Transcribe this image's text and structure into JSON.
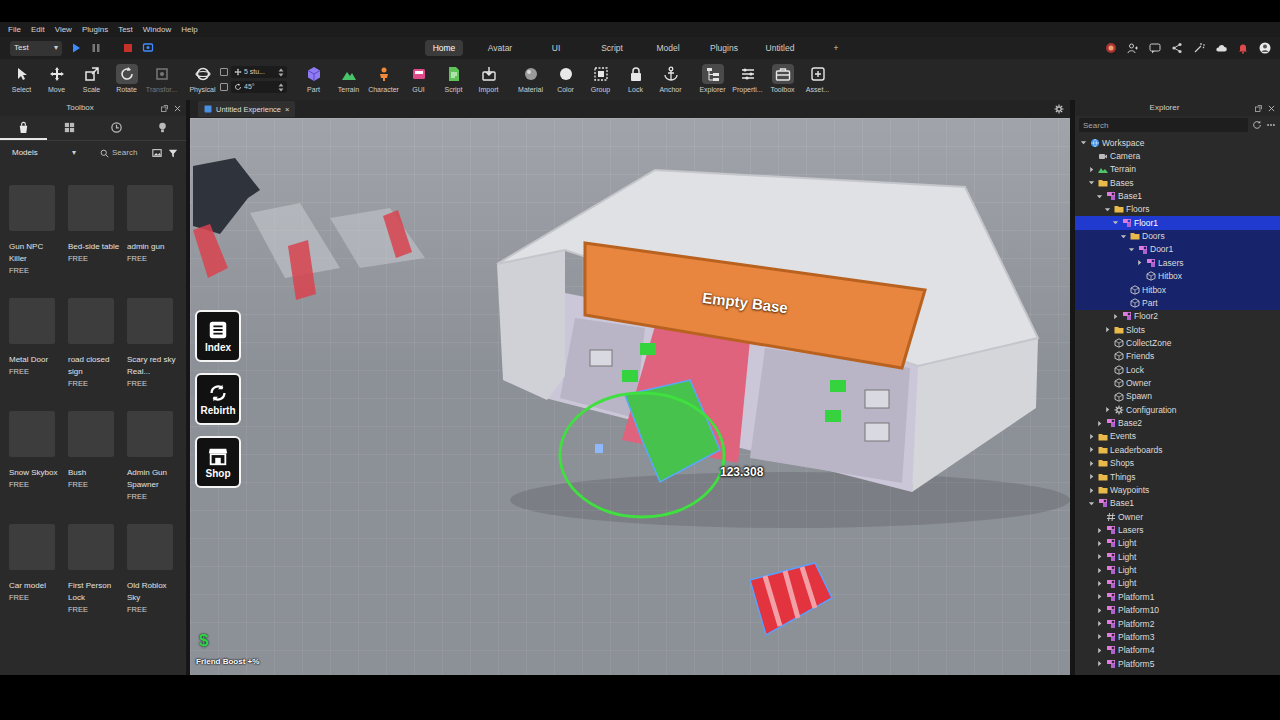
{
  "menu": [
    "File",
    "Edit",
    "View",
    "Plugins",
    "Test",
    "Window",
    "Help"
  ],
  "mode_select": {
    "label": "Test",
    "arrow": "▾"
  },
  "tabs": [
    {
      "label": "Home",
      "selected": true
    },
    {
      "label": "Avatar",
      "selected": false
    },
    {
      "label": "UI",
      "selected": false
    },
    {
      "label": "Script",
      "selected": false
    },
    {
      "label": "Model",
      "selected": false
    },
    {
      "label": "Plugins",
      "selected": false
    },
    {
      "label": "Untitled",
      "selected": false
    },
    {
      "label": "+",
      "selected": false
    }
  ],
  "ribbon": {
    "groups": [
      {
        "kind": "tools",
        "items": [
          {
            "label": "Select",
            "selected": false,
            "disabled": false
          },
          {
            "label": "Move",
            "selected": false,
            "disabled": false
          },
          {
            "label": "Scale",
            "selected": false,
            "disabled": false
          },
          {
            "label": "Rotate",
            "selected": true,
            "disabled": false
          },
          {
            "label": "Transfor...",
            "selected": false,
            "disabled": true
          }
        ]
      },
      {
        "kind": "snap",
        "label": "Physical",
        "fields": [
          {
            "value": "5 stu...",
            "checked": false
          },
          {
            "value": "45°",
            "checked": false
          }
        ]
      },
      {
        "kind": "tools",
        "items": [
          {
            "label": "Part",
            "selected": false,
            "disabled": false
          },
          {
            "label": "Terrain",
            "selected": false,
            "disabled": false
          },
          {
            "label": "Character",
            "selected": false,
            "disabled": false
          },
          {
            "label": "GUI",
            "selected": false,
            "disabled": false
          },
          {
            "label": "Script",
            "selected": false,
            "disabled": false
          },
          {
            "label": "Import",
            "selected": false,
            "disabled": false
          }
        ]
      },
      {
        "kind": "tools",
        "items": [
          {
            "label": "Material",
            "selected": false,
            "disabled": false
          },
          {
            "label": "Color",
            "selected": false,
            "disabled": false
          },
          {
            "label": "Group",
            "selected": false,
            "disabled": false
          },
          {
            "label": "Lock",
            "selected": false,
            "disabled": false
          },
          {
            "label": "Anchor",
            "selected": false,
            "disabled": false
          }
        ]
      },
      {
        "kind": "tools",
        "items": [
          {
            "label": "Explorer",
            "selected": true,
            "disabled": false
          },
          {
            "label": "Properti...",
            "selected": false,
            "disabled": false
          },
          {
            "label": "Toolbox",
            "selected": true,
            "disabled": false
          },
          {
            "label": "Asset...",
            "selected": false,
            "disabled": false
          }
        ]
      }
    ]
  },
  "toolbox": {
    "title": "Toolbox",
    "tabs": [
      {
        "selected": true
      },
      {
        "selected": false
      },
      {
        "selected": false
      },
      {
        "selected": false
      }
    ],
    "category": {
      "label": "Models",
      "arrow": "▾"
    },
    "search": {
      "label": "Search"
    },
    "items": [
      {
        "name": "Gun NPC Killer",
        "price": "FREE"
      },
      {
        "name": "Bed-side table",
        "price": "FREE"
      },
      {
        "name": "admin gun",
        "price": "FREE"
      },
      {
        "name": "Metal Door",
        "price": "FREE"
      },
      {
        "name": "road closed sign",
        "price": "FREE"
      },
      {
        "name": "Scary red sky Real...",
        "price": "FREE"
      },
      {
        "name": "Snow Skybox",
        "price": "FREE"
      },
      {
        "name": "Bush",
        "price": "FREE"
      },
      {
        "name": "Admin Gun Spawner",
        "price": "FREE"
      },
      {
        "name": "Car model",
        "price": "FREE"
      },
      {
        "name": "First Person Lock",
        "price": "FREE"
      },
      {
        "name": "Old Roblox Sky",
        "price": "FREE"
      }
    ]
  },
  "viewport": {
    "tab": {
      "label": "Untitled Experience",
      "close": "×"
    },
    "hud_buttons": [
      {
        "label": "Index"
      },
      {
        "label": "Rebirth"
      },
      {
        "label": "Shop"
      }
    ],
    "currency_icon": "$",
    "friend_boost": "Friend Boost +%",
    "sign": "Empty Base",
    "rotation_readout": "123.308"
  },
  "explorer": {
    "title": "Explorer",
    "search": {
      "placeholder": "Search"
    },
    "items": [
      {
        "name": "Workspace",
        "depth": 0,
        "kind": "service",
        "toggle": "open",
        "selected": false,
        "highlighted": false
      },
      {
        "name": "Camera",
        "depth": 1,
        "kind": "camera",
        "toggle": "none",
        "selected": false,
        "highlighted": false
      },
      {
        "name": "Terrain",
        "depth": 1,
        "kind": "terrain",
        "toggle": "closed",
        "selected": false,
        "highlighted": false
      },
      {
        "name": "Bases",
        "depth": 1,
        "kind": "folder",
        "toggle": "open",
        "selected": false,
        "highlighted": false
      },
      {
        "name": "Base1",
        "depth": 2,
        "kind": "model",
        "toggle": "open",
        "selected": false,
        "highlighted": false
      },
      {
        "name": "Floors",
        "depth": 3,
        "kind": "folder",
        "toggle": "open",
        "selected": false,
        "highlighted": false
      },
      {
        "name": "Floor1",
        "depth": 4,
        "kind": "model",
        "toggle": "open",
        "selected": true,
        "highlighted": false
      },
      {
        "name": "Doors",
        "depth": 5,
        "kind": "folder",
        "toggle": "open",
        "selected": false,
        "highlighted": true
      },
      {
        "name": "Door1",
        "depth": 6,
        "kind": "model",
        "toggle": "open",
        "selected": false,
        "highlighted": true
      },
      {
        "name": "Lasers",
        "depth": 7,
        "kind": "model",
        "toggle": "closed",
        "selected": false,
        "highlighted": true
      },
      {
        "name": "Hitbox",
        "depth": 7,
        "kind": "part",
        "toggle": "none",
        "selected": false,
        "highlighted": true
      },
      {
        "name": "Hitbox",
        "depth": 5,
        "kind": "part",
        "toggle": "none",
        "selected": false,
        "highlighted": true
      },
      {
        "name": "Part",
        "depth": 5,
        "kind": "part",
        "toggle": "none",
        "selected": false,
        "highlighted": true
      },
      {
        "name": "Floor2",
        "depth": 4,
        "kind": "model",
        "toggle": "closed",
        "selected": false,
        "highlighted": false
      },
      {
        "name": "Slots",
        "depth": 3,
        "kind": "folder",
        "toggle": "closed",
        "selected": false,
        "highlighted": false
      },
      {
        "name": "CollectZone",
        "depth": 3,
        "kind": "part",
        "toggle": "none",
        "selected": false,
        "highlighted": false
      },
      {
        "name": "Friends",
        "depth": 3,
        "kind": "part",
        "toggle": "none",
        "selected": false,
        "highlighted": false
      },
      {
        "name": "Lock",
        "depth": 3,
        "kind": "part",
        "toggle": "none",
        "selected": false,
        "highlighted": false
      },
      {
        "name": "Owner",
        "depth": 3,
        "kind": "part",
        "toggle": "none",
        "selected": false,
        "highlighted": false
      },
      {
        "name": "Spawn",
        "depth": 3,
        "kind": "part",
        "toggle": "none",
        "selected": false,
        "highlighted": false
      },
      {
        "name": "Configuration",
        "depth": 3,
        "kind": "config",
        "toggle": "closed",
        "selected": false,
        "highlighted": false
      },
      {
        "name": "Base2",
        "depth": 2,
        "kind": "model",
        "toggle": "closed",
        "selected": false,
        "highlighted": false
      },
      {
        "name": "Events",
        "depth": 1,
        "kind": "folder",
        "toggle": "closed",
        "selected": false,
        "highlighted": false
      },
      {
        "name": "Leaderboards",
        "depth": 1,
        "kind": "folder",
        "toggle": "closed",
        "selected": false,
        "highlighted": false
      },
      {
        "name": "Shops",
        "depth": 1,
        "kind": "folder",
        "toggle": "closed",
        "selected": false,
        "highlighted": false
      },
      {
        "name": "Things",
        "depth": 1,
        "kind": "folder",
        "toggle": "closed",
        "selected": false,
        "highlighted": false
      },
      {
        "name": "Waypoints",
        "depth": 1,
        "kind": "folder",
        "toggle": "closed",
        "selected": false,
        "highlighted": false
      },
      {
        "name": "Base1",
        "depth": 1,
        "kind": "model",
        "toggle": "open",
        "selected": false,
        "highlighted": false
      },
      {
        "name": "Owner",
        "depth": 2,
        "kind": "value",
        "toggle": "none",
        "selected": false,
        "highlighted": false
      },
      {
        "name": "Lasers",
        "depth": 2,
        "kind": "model",
        "toggle": "closed",
        "selected": false,
        "highlighted": false
      },
      {
        "name": "Light",
        "depth": 2,
        "kind": "model",
        "toggle": "closed",
        "selected": false,
        "highlighted": false
      },
      {
        "name": "Light",
        "depth": 2,
        "kind": "model",
        "toggle": "closed",
        "selected": false,
        "highlighted": false
      },
      {
        "name": "Light",
        "depth": 2,
        "kind": "model",
        "toggle": "closed",
        "selected": false,
        "highlighted": false
      },
      {
        "name": "Light",
        "depth": 2,
        "kind": "model",
        "toggle": "closed",
        "selected": false,
        "highlighted": false
      },
      {
        "name": "Platform1",
        "depth": 2,
        "kind": "model",
        "toggle": "closed",
        "selected": false,
        "highlighted": false
      },
      {
        "name": "Platform10",
        "depth": 2,
        "kind": "model",
        "toggle": "closed",
        "selected": false,
        "highlighted": false
      },
      {
        "name": "Platform2",
        "depth": 2,
        "kind": "model",
        "toggle": "closed",
        "selected": false,
        "highlighted": false
      },
      {
        "name": "Platform3",
        "depth": 2,
        "kind": "model",
        "toggle": "closed",
        "selected": false,
        "highlighted": false
      },
      {
        "name": "Platform4",
        "depth": 2,
        "kind": "model",
        "toggle": "closed",
        "selected": false,
        "highlighted": false
      },
      {
        "name": "Platform5",
        "depth": 2,
        "kind": "model",
        "toggle": "closed",
        "selected": false,
        "highlighted": false
      }
    ]
  }
}
